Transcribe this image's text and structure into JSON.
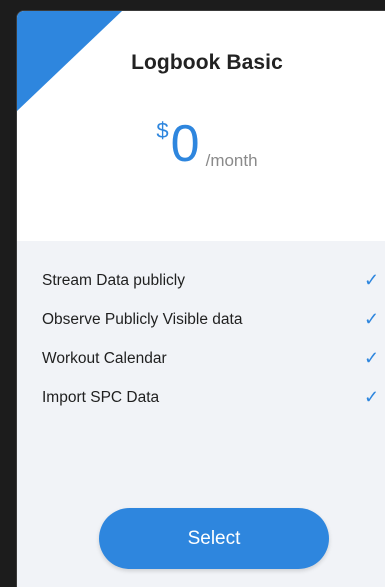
{
  "plan": {
    "name": "Logbook Basic",
    "currency": "$",
    "amount": "0",
    "period": "/month"
  },
  "features": [
    {
      "label": "Stream Data publicly",
      "check": "✓"
    },
    {
      "label": "Observe Publicly Visible data",
      "check": "✓"
    },
    {
      "label": "Workout Calendar",
      "check": "✓"
    },
    {
      "label": "Import SPC Data",
      "check": "✓"
    }
  ],
  "actions": {
    "select_label": "Select"
  },
  "colors": {
    "accent": "#2e86de",
    "background": "#1c1c1c",
    "features_bg": "#f1f3f7"
  },
  "icons": {
    "corner": "corner-ribbon-icon",
    "feature": "check-icon"
  }
}
